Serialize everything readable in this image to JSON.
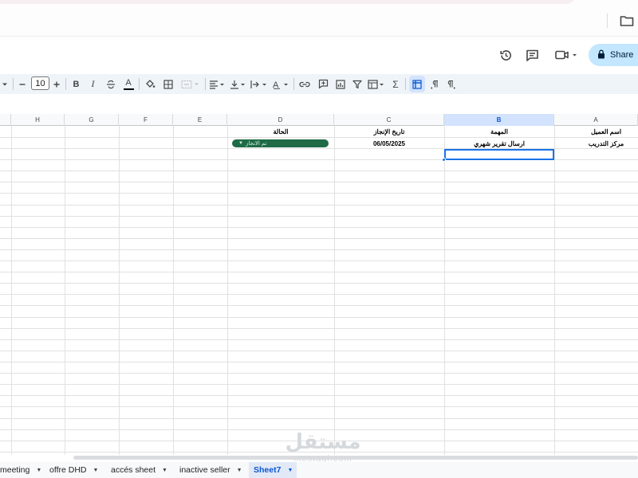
{
  "toolbar": {
    "font_size": "10",
    "items": [
      "minus",
      "plus",
      "bold",
      "italic",
      "strikethrough",
      "text-color",
      "fill-color",
      "borders",
      "merge",
      "align",
      "valign",
      "wrap",
      "rotate",
      "link",
      "comment",
      "chart",
      "filter",
      "functions",
      "sum",
      "rtl",
      "ltr"
    ],
    "bold_label": "B",
    "italic_label": "I",
    "text_color_label": "A",
    "sum_label": "Σ"
  },
  "header": {
    "share_label": "Share"
  },
  "grid": {
    "columns": [
      "H",
      "G",
      "F",
      "E",
      "D",
      "C",
      "B",
      "A"
    ],
    "selected_column": "B",
    "header_row": {
      "A": "اسم العميل",
      "B": "المهمة",
      "C": "تاريخ الإنجاز",
      "D": "الحالة"
    },
    "data_row": {
      "A": "مركز التدريب",
      "B": "ارسال تقرير شهري",
      "C": "06/05/2025",
      "D": "تم الانجاز"
    }
  },
  "sheets": [
    {
      "name": "meeting",
      "active": false
    },
    {
      "name": "offre DHD",
      "active": false
    },
    {
      "name": "accés sheet",
      "active": false
    },
    {
      "name": "inactive seller",
      "active": false
    },
    {
      "name": "Sheet7",
      "active": true
    }
  ],
  "watermark": {
    "arabic": "مستقل",
    "latin": "mostaql.com"
  },
  "colors": {
    "accent": "#0b57d0",
    "status_chip": "#1f6b46",
    "share_bg": "#c2e7ff",
    "toolbar_bg": "#eff4f9"
  }
}
